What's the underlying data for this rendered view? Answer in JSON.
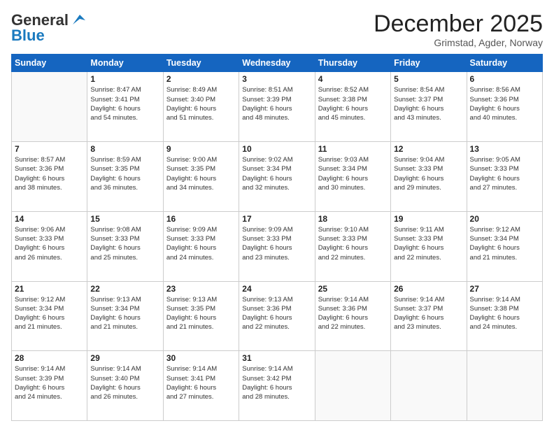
{
  "header": {
    "logo_line1": "General",
    "logo_line2": "Blue",
    "month": "December 2025",
    "location": "Grimstad, Agder, Norway"
  },
  "weekdays": [
    "Sunday",
    "Monday",
    "Tuesday",
    "Wednesday",
    "Thursday",
    "Friday",
    "Saturday"
  ],
  "weeks": [
    [
      {
        "day": "",
        "info": ""
      },
      {
        "day": "1",
        "info": "Sunrise: 8:47 AM\nSunset: 3:41 PM\nDaylight: 6 hours\nand 54 minutes."
      },
      {
        "day": "2",
        "info": "Sunrise: 8:49 AM\nSunset: 3:40 PM\nDaylight: 6 hours\nand 51 minutes."
      },
      {
        "day": "3",
        "info": "Sunrise: 8:51 AM\nSunset: 3:39 PM\nDaylight: 6 hours\nand 48 minutes."
      },
      {
        "day": "4",
        "info": "Sunrise: 8:52 AM\nSunset: 3:38 PM\nDaylight: 6 hours\nand 45 minutes."
      },
      {
        "day": "5",
        "info": "Sunrise: 8:54 AM\nSunset: 3:37 PM\nDaylight: 6 hours\nand 43 minutes."
      },
      {
        "day": "6",
        "info": "Sunrise: 8:56 AM\nSunset: 3:36 PM\nDaylight: 6 hours\nand 40 minutes."
      }
    ],
    [
      {
        "day": "7",
        "info": "Sunrise: 8:57 AM\nSunset: 3:36 PM\nDaylight: 6 hours\nand 38 minutes."
      },
      {
        "day": "8",
        "info": "Sunrise: 8:59 AM\nSunset: 3:35 PM\nDaylight: 6 hours\nand 36 minutes."
      },
      {
        "day": "9",
        "info": "Sunrise: 9:00 AM\nSunset: 3:35 PM\nDaylight: 6 hours\nand 34 minutes."
      },
      {
        "day": "10",
        "info": "Sunrise: 9:02 AM\nSunset: 3:34 PM\nDaylight: 6 hours\nand 32 minutes."
      },
      {
        "day": "11",
        "info": "Sunrise: 9:03 AM\nSunset: 3:34 PM\nDaylight: 6 hours\nand 30 minutes."
      },
      {
        "day": "12",
        "info": "Sunrise: 9:04 AM\nSunset: 3:33 PM\nDaylight: 6 hours\nand 29 minutes."
      },
      {
        "day": "13",
        "info": "Sunrise: 9:05 AM\nSunset: 3:33 PM\nDaylight: 6 hours\nand 27 minutes."
      }
    ],
    [
      {
        "day": "14",
        "info": "Sunrise: 9:06 AM\nSunset: 3:33 PM\nDaylight: 6 hours\nand 26 minutes."
      },
      {
        "day": "15",
        "info": "Sunrise: 9:08 AM\nSunset: 3:33 PM\nDaylight: 6 hours\nand 25 minutes."
      },
      {
        "day": "16",
        "info": "Sunrise: 9:09 AM\nSunset: 3:33 PM\nDaylight: 6 hours\nand 24 minutes."
      },
      {
        "day": "17",
        "info": "Sunrise: 9:09 AM\nSunset: 3:33 PM\nDaylight: 6 hours\nand 23 minutes."
      },
      {
        "day": "18",
        "info": "Sunrise: 9:10 AM\nSunset: 3:33 PM\nDaylight: 6 hours\nand 22 minutes."
      },
      {
        "day": "19",
        "info": "Sunrise: 9:11 AM\nSunset: 3:33 PM\nDaylight: 6 hours\nand 22 minutes."
      },
      {
        "day": "20",
        "info": "Sunrise: 9:12 AM\nSunset: 3:34 PM\nDaylight: 6 hours\nand 21 minutes."
      }
    ],
    [
      {
        "day": "21",
        "info": "Sunrise: 9:12 AM\nSunset: 3:34 PM\nDaylight: 6 hours\nand 21 minutes."
      },
      {
        "day": "22",
        "info": "Sunrise: 9:13 AM\nSunset: 3:34 PM\nDaylight: 6 hours\nand 21 minutes."
      },
      {
        "day": "23",
        "info": "Sunrise: 9:13 AM\nSunset: 3:35 PM\nDaylight: 6 hours\nand 21 minutes."
      },
      {
        "day": "24",
        "info": "Sunrise: 9:13 AM\nSunset: 3:36 PM\nDaylight: 6 hours\nand 22 minutes."
      },
      {
        "day": "25",
        "info": "Sunrise: 9:14 AM\nSunset: 3:36 PM\nDaylight: 6 hours\nand 22 minutes."
      },
      {
        "day": "26",
        "info": "Sunrise: 9:14 AM\nSunset: 3:37 PM\nDaylight: 6 hours\nand 23 minutes."
      },
      {
        "day": "27",
        "info": "Sunrise: 9:14 AM\nSunset: 3:38 PM\nDaylight: 6 hours\nand 24 minutes."
      }
    ],
    [
      {
        "day": "28",
        "info": "Sunrise: 9:14 AM\nSunset: 3:39 PM\nDaylight: 6 hours\nand 24 minutes."
      },
      {
        "day": "29",
        "info": "Sunrise: 9:14 AM\nSunset: 3:40 PM\nDaylight: 6 hours\nand 26 minutes."
      },
      {
        "day": "30",
        "info": "Sunrise: 9:14 AM\nSunset: 3:41 PM\nDaylight: 6 hours\nand 27 minutes."
      },
      {
        "day": "31",
        "info": "Sunrise: 9:14 AM\nSunset: 3:42 PM\nDaylight: 6 hours\nand 28 minutes."
      },
      {
        "day": "",
        "info": ""
      },
      {
        "day": "",
        "info": ""
      },
      {
        "day": "",
        "info": ""
      }
    ]
  ]
}
